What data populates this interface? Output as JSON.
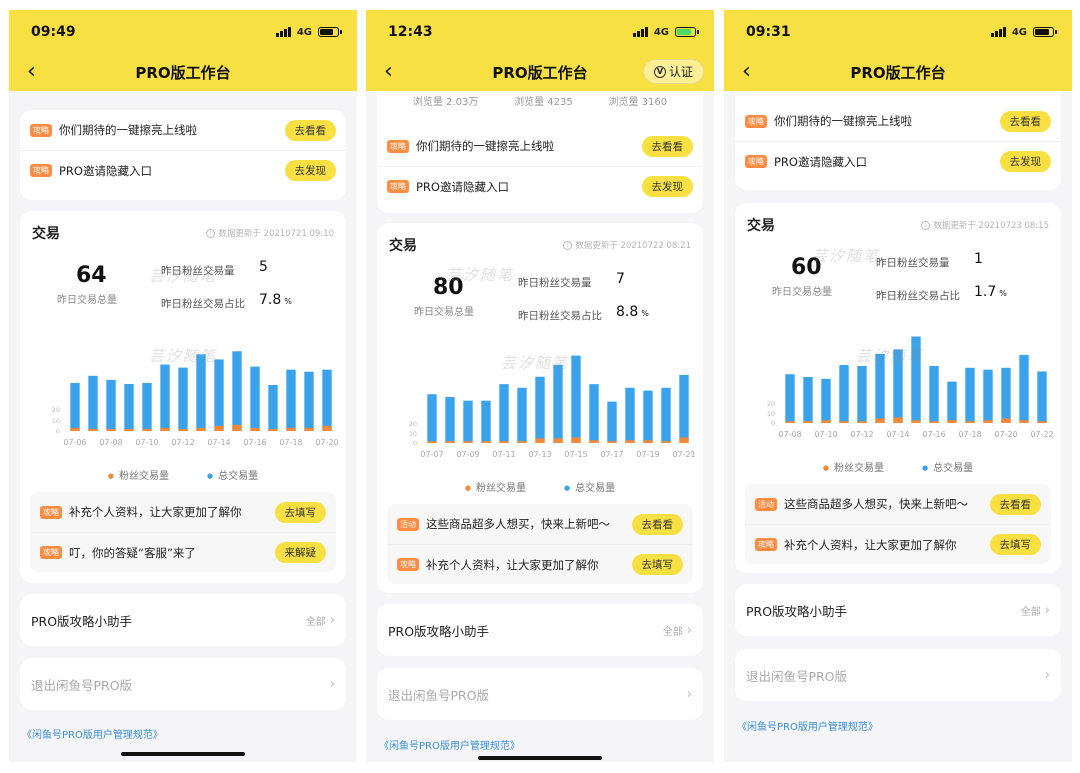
{
  "screens": [
    {
      "time": "09:49",
      "network": "4G",
      "title": "PRO版工作台",
      "battery_level": 0.75,
      "charging": false,
      "verify_label": "",
      "stats": null,
      "tips_top": [
        {
          "tag": "攻略",
          "text": "你们期待的一键擦亮上线啦",
          "action": "去看看"
        },
        {
          "tag": "攻略",
          "text": "PRO邀请隐藏入口",
          "action": "去发现"
        }
      ],
      "trade": {
        "title": "交易",
        "updated": "数据更新于 20210721 09:10",
        "total": "64",
        "total_label": "昨日交易总量",
        "fans_label": "昨日粉丝交易量",
        "fans_value": "5",
        "ratio_label": "昨日粉丝交易占比",
        "ratio_value": "7.8",
        "ratio_unit": "%"
      },
      "tips_bottom": [
        {
          "tag": "攻略",
          "text": "补充个人资料，让大家更加了解你",
          "action": "去填写"
        },
        {
          "tag": "攻略",
          "text": "叮，你的答疑“客服”来了",
          "action": "来解疑"
        }
      ],
      "helper_title": "PRO版攻略小助手",
      "helper_more": "全部",
      "exit_label": "退出闲鱼号PRO版",
      "footer_link": "《闲鱼号PRO版用户管理规范》"
    },
    {
      "time": "12:43",
      "network": "4G",
      "title": "PRO版工作台",
      "battery_level": 0.85,
      "charging": true,
      "verify_label": "认证",
      "stats": [
        "浏览量 2.03万",
        "浏览量 4235",
        "浏览量 3160"
      ],
      "tips_top": [
        {
          "tag": "攻略",
          "text": "你们期待的一键擦亮上线啦",
          "action": "去看看"
        },
        {
          "tag": "攻略",
          "text": "PRO邀请隐藏入口",
          "action": "去发现"
        }
      ],
      "trade": {
        "title": "交易",
        "updated": "数据更新于 20210722 08:21",
        "total": "80",
        "total_label": "昨日交易总量",
        "fans_label": "昨日粉丝交易量",
        "fans_value": "7",
        "ratio_label": "昨日粉丝交易占比",
        "ratio_value": "8.8",
        "ratio_unit": "%"
      },
      "tips_bottom": [
        {
          "tag": "活动",
          "text": "这些商品超多人想买，快来上新吧～",
          "action": "去看看"
        },
        {
          "tag": "攻略",
          "text": "补充个人资料，让大家更加了解你",
          "action": "去填写"
        }
      ],
      "helper_title": "PRO版攻略小助手",
      "helper_more": "全部",
      "exit_label": "退出闲鱼号PRO版",
      "footer_link": "《闲鱼号PRO版用户管理规范》"
    },
    {
      "time": "09:31",
      "network": "4G",
      "title": "PRO版工作台",
      "battery_level": 0.8,
      "charging": false,
      "verify_label": "",
      "stats": null,
      "tips_top": [
        {
          "tag": "攻略",
          "text": "你们期待的一键擦亮上线啦",
          "action": "去看看"
        },
        {
          "tag": "攻略",
          "text": "PRO邀请隐藏入口",
          "action": "去发现"
        }
      ],
      "trade": {
        "title": "交易",
        "updated": "数据更新于 20210723 08:15",
        "total": "60",
        "total_label": "昨日交易总量",
        "fans_label": "昨日粉丝交易量",
        "fans_value": "1",
        "ratio_label": "昨日粉丝交易占比",
        "ratio_value": "1.7",
        "ratio_unit": "%"
      },
      "tips_bottom": [
        {
          "tag": "活动",
          "text": "这些商品超多人想买，快来上新吧～",
          "action": "去看看"
        },
        {
          "tag": "攻略",
          "text": "补充个人资料，让大家更加了解你",
          "action": "去填写"
        }
      ],
      "helper_title": "PRO版攻略小助手",
      "helper_more": "全部",
      "exit_label": "退出闲鱼号PRO版",
      "footer_link": "《闲鱼号PRO版用户管理规范》"
    }
  ],
  "watermark": "芸汐随笔",
  "legend": {
    "fans": "粉丝交易量",
    "total": "总交易量"
  },
  "colors": {
    "header": "#f8e042",
    "total_bar": "#3aa3ec",
    "fans_bar": "#f08a3a",
    "tag": "#ff8c42",
    "link": "#3a8fd6"
  },
  "chart_data": [
    {
      "type": "bar",
      "stacked": true,
      "categories": [
        "07-06",
        "07-07",
        "07-08",
        "07-09",
        "07-10",
        "07-11",
        "07-12",
        "07-13",
        "07-14",
        "07-15",
        "07-16",
        "07-17",
        "07-18",
        "07-19",
        "07-20"
      ],
      "tick_labels": [
        "07-06",
        "07-08",
        "07-10",
        "07-12",
        "07-14",
        "07-16",
        "07-18",
        "07-20"
      ],
      "y_ticks": [
        "0",
        "10",
        "20"
      ],
      "series": [
        {
          "name": "粉丝交易量",
          "values": [
            3,
            2,
            2,
            2,
            2,
            3,
            2,
            3,
            5,
            6,
            3,
            2,
            3,
            3,
            5
          ]
        },
        {
          "name": "总交易量",
          "values": [
            47,
            54,
            50,
            46,
            47,
            65,
            62,
            75,
            70,
            78,
            63,
            45,
            60,
            58,
            60
          ]
        }
      ],
      "ylim": [
        0,
        90
      ]
    },
    {
      "type": "bar",
      "stacked": true,
      "categories": [
        "07-07",
        "07-08",
        "07-09",
        "07-10",
        "07-11",
        "07-12",
        "07-13",
        "07-14",
        "07-15",
        "07-16",
        "07-17",
        "07-18",
        "07-19",
        "07-20",
        "07-21"
      ],
      "tick_labels": [
        "07-07",
        "07-09",
        "07-11",
        "07-13",
        "07-15",
        "07-17",
        "07-19",
        "07-21"
      ],
      "y_ticks": [
        "0",
        "10",
        "20"
      ],
      "series": [
        {
          "name": "粉丝交易量",
          "values": [
            2,
            2,
            2,
            2,
            2,
            2,
            5,
            5,
            6,
            3,
            2,
            3,
            3,
            2,
            6
          ]
        },
        {
          "name": "总交易量",
          "values": [
            53,
            50,
            46,
            46,
            64,
            60,
            72,
            85,
            95,
            64,
            45,
            60,
            57,
            60,
            74
          ]
        }
      ],
      "ylim": [
        0,
        100
      ]
    },
    {
      "type": "bar",
      "stacked": true,
      "categories": [
        "07-08",
        "07-09",
        "07-10",
        "07-11",
        "07-12",
        "07-13",
        "07-14",
        "07-15",
        "07-16",
        "07-17",
        "07-18",
        "07-19",
        "07-20",
        "07-21",
        "07-22"
      ],
      "tick_labels": [
        "07-08",
        "07-10",
        "07-12",
        "07-14",
        "07-16",
        "07-18",
        "07-20",
        "07-22"
      ],
      "y_ticks": [
        "0",
        "10",
        "20"
      ],
      "series": [
        {
          "name": "粉丝交易量",
          "values": [
            2,
            2,
            3,
            2,
            2,
            5,
            6,
            3,
            2,
            3,
            2,
            3,
            5,
            3,
            2
          ]
        },
        {
          "name": "总交易量",
          "values": [
            53,
            50,
            48,
            63,
            62,
            75,
            80,
            94,
            62,
            45,
            60,
            58,
            60,
            74,
            56
          ]
        }
      ],
      "ylim": [
        0,
        100
      ]
    }
  ]
}
